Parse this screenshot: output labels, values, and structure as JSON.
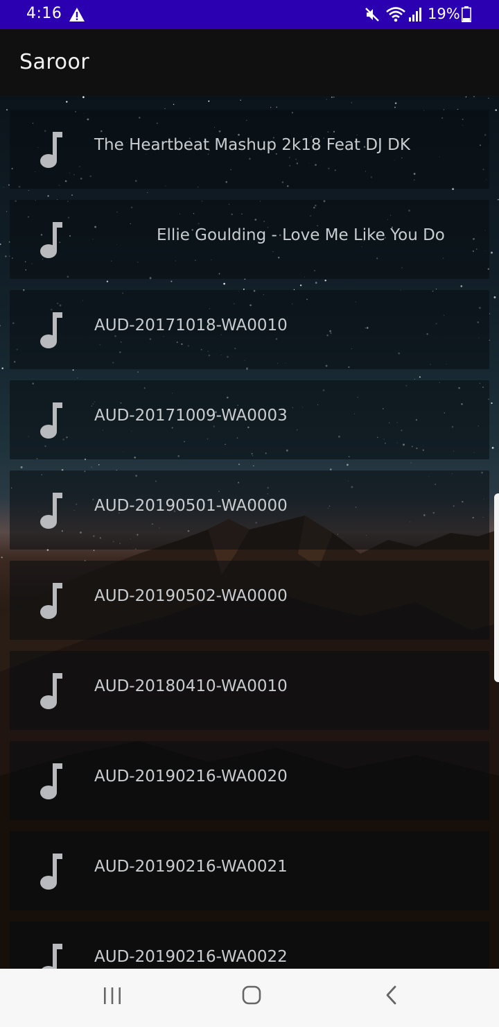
{
  "status_bar": {
    "time": "4:16",
    "battery": "19%",
    "icons": [
      "warning-icon",
      "mute-icon",
      "wifi-icon",
      "signal-icon",
      "battery-icon"
    ]
  },
  "app_bar": {
    "title": "Saroor"
  },
  "songs": [
    {
      "title": "The Heartbeat Mashup 2k18 Feat DJ DK",
      "icon": "music-note-icon"
    },
    {
      "title": "Ellie Goulding - Love Me Like You Do",
      "icon": "music-note-icon"
    },
    {
      "title": "AUD-20171018-WA0010",
      "icon": "music-note-icon"
    },
    {
      "title": "AUD-20171009-WA0003",
      "icon": "music-note-icon"
    },
    {
      "title": "AUD-20190501-WA0000",
      "icon": "music-note-icon"
    },
    {
      "title": "AUD-20190502-WA0000",
      "icon": "music-note-icon"
    },
    {
      "title": "AUD-20180410-WA0010",
      "icon": "music-note-icon"
    },
    {
      "title": "AUD-20190216-WA0020",
      "icon": "music-note-icon"
    },
    {
      "title": "AUD-20190216-WA0021",
      "icon": "music-note-icon"
    },
    {
      "title": "AUD-20190216-WA0022",
      "icon": "music-note-icon"
    }
  ],
  "nav_bar": {
    "icons": [
      "recents-icon",
      "home-icon",
      "back-icon"
    ]
  },
  "colors": {
    "status_bar": "#2a00b0",
    "app_bar": "#101010",
    "card_text": "#c9cdd0",
    "nav_bar": "#f7f7f7"
  }
}
